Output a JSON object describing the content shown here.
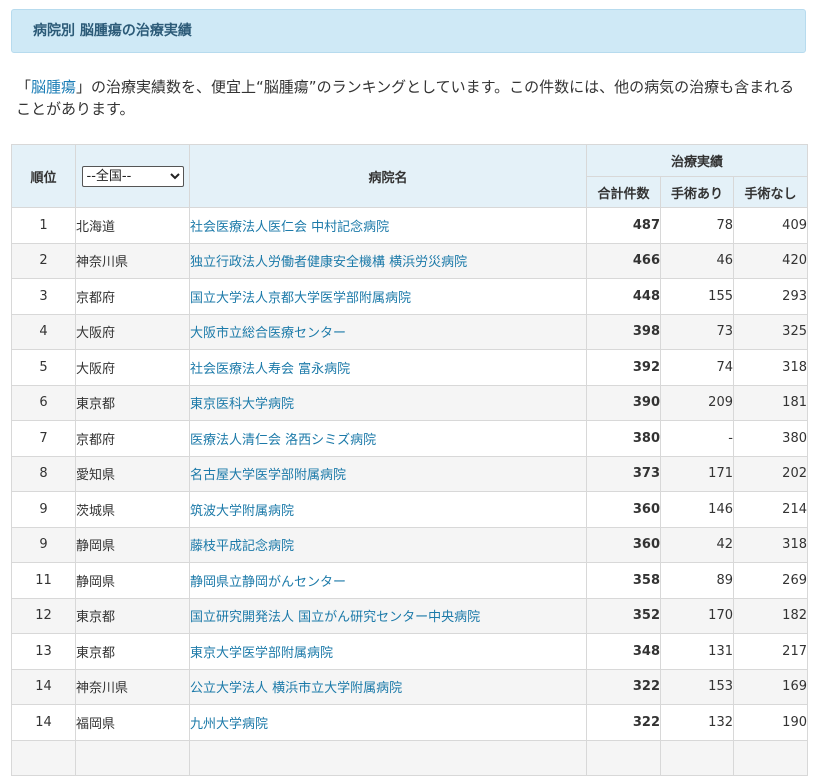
{
  "heading": "病院別 脳腫瘍の治療実績",
  "intro": {
    "open": "「",
    "keyword": "脳腫瘍",
    "rest": "」の治療実績数を、便宜上“脳腫瘍”のランキングとしています。この件数には、他の病気の治療も含まれることがあります。"
  },
  "table": {
    "headers": {
      "rank": "順位",
      "hospital": "病院名",
      "results": "治療実績",
      "total": "合計件数",
      "surgery": "手術あり",
      "no_surgery": "手術なし"
    },
    "region_select": {
      "selected": "--全国--"
    },
    "rows": [
      {
        "rank": "1",
        "pref": "北海道",
        "name": "社会医療法人医仁会 中村記念病院",
        "total": "487",
        "surgery": "78",
        "no_surgery": "409"
      },
      {
        "rank": "2",
        "pref": "神奈川県",
        "name": "独立行政法人労働者健康安全機構 横浜労災病院",
        "total": "466",
        "surgery": "46",
        "no_surgery": "420"
      },
      {
        "rank": "3",
        "pref": "京都府",
        "name": "国立大学法人京都大学医学部附属病院",
        "total": "448",
        "surgery": "155",
        "no_surgery": "293"
      },
      {
        "rank": "4",
        "pref": "大阪府",
        "name": "大阪市立総合医療センター",
        "total": "398",
        "surgery": "73",
        "no_surgery": "325"
      },
      {
        "rank": "5",
        "pref": "大阪府",
        "name": "社会医療法人寿会 富永病院",
        "total": "392",
        "surgery": "74",
        "no_surgery": "318"
      },
      {
        "rank": "6",
        "pref": "東京都",
        "name": "東京医科大学病院",
        "total": "390",
        "surgery": "209",
        "no_surgery": "181"
      },
      {
        "rank": "7",
        "pref": "京都府",
        "name": "医療法人清仁会 洛西シミズ病院",
        "total": "380",
        "surgery": "-",
        "no_surgery": "380"
      },
      {
        "rank": "8",
        "pref": "愛知県",
        "name": "名古屋大学医学部附属病院",
        "total": "373",
        "surgery": "171",
        "no_surgery": "202"
      },
      {
        "rank": "9",
        "pref": "茨城県",
        "name": "筑波大学附属病院",
        "total": "360",
        "surgery": "146",
        "no_surgery": "214"
      },
      {
        "rank": "9",
        "pref": "静岡県",
        "name": "藤枝平成記念病院",
        "total": "360",
        "surgery": "42",
        "no_surgery": "318"
      },
      {
        "rank": "11",
        "pref": "静岡県",
        "name": "静岡県立静岡がんセンター",
        "total": "358",
        "surgery": "89",
        "no_surgery": "269"
      },
      {
        "rank": "12",
        "pref": "東京都",
        "name": "国立研究開発法人 国立がん研究センター中央病院",
        "total": "352",
        "surgery": "170",
        "no_surgery": "182"
      },
      {
        "rank": "13",
        "pref": "東京都",
        "name": "東京大学医学部附属病院",
        "total": "348",
        "surgery": "131",
        "no_surgery": "217"
      },
      {
        "rank": "14",
        "pref": "神奈川県",
        "name": "公立大学法人 横浜市立大学附属病院",
        "total": "322",
        "surgery": "153",
        "no_surgery": "169"
      },
      {
        "rank": "14",
        "pref": "福岡県",
        "name": "九州大学病院",
        "total": "322",
        "surgery": "132",
        "no_surgery": "190"
      },
      {
        "rank": "",
        "pref": "",
        "name": "",
        "total": "",
        "surgery": "",
        "no_surgery": ""
      }
    ]
  }
}
